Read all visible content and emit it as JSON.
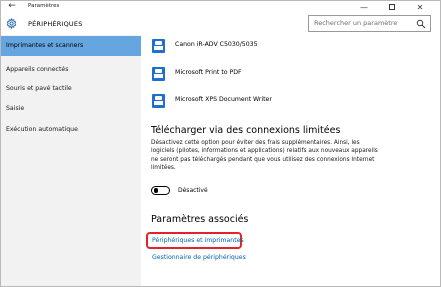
{
  "window": {
    "back_glyph": "←",
    "title": "Paramètres",
    "minimize_glyph": "—",
    "close_glyph": "✕"
  },
  "header": {
    "title": "PÉRIPHÉRIQUES",
    "search_placeholder": "Rechercher un paramètre"
  },
  "sidebar": {
    "items": [
      {
        "label": "Imprimantes et scanners",
        "active": true
      },
      {
        "label": "Appareils connectés",
        "active": false
      },
      {
        "label": "Souris et pavé tactile",
        "active": false
      },
      {
        "label": "Saisie",
        "active": false
      },
      {
        "label": "Exécution automatique",
        "active": false
      }
    ]
  },
  "devices": [
    {
      "name": "Canon iR-ADV C5030/5035",
      "icon": "printer-icon"
    },
    {
      "name": "Microsoft Print to PDF",
      "icon": "printer-icon"
    },
    {
      "name": "Microsoft XPS Document Writer",
      "icon": "printer-icon"
    }
  ],
  "metered": {
    "heading": "Télécharger via des connexions limitées",
    "description": "Désactivez cette option pour éviter des frais supplémentaires. Ainsi, les logiciels (pilotes, informations et applications) relatifs aux nouveaux appareils ne seront pas téléchargés pendant que vous utilisez des connexions Internet limitées.",
    "toggle_state": "Désactivé",
    "toggle_on": false
  },
  "related": {
    "heading": "Paramètres associés",
    "links": [
      {
        "label": "Périphériques et imprimantes",
        "highlighted": true
      },
      {
        "label": "Gestionnaire de périphériques",
        "highlighted": false
      }
    ]
  },
  "colors": {
    "accent": "#66a6e0",
    "link": "#0063b1",
    "highlight": "#e0242b",
    "device_icon": "#1f6fd0"
  }
}
